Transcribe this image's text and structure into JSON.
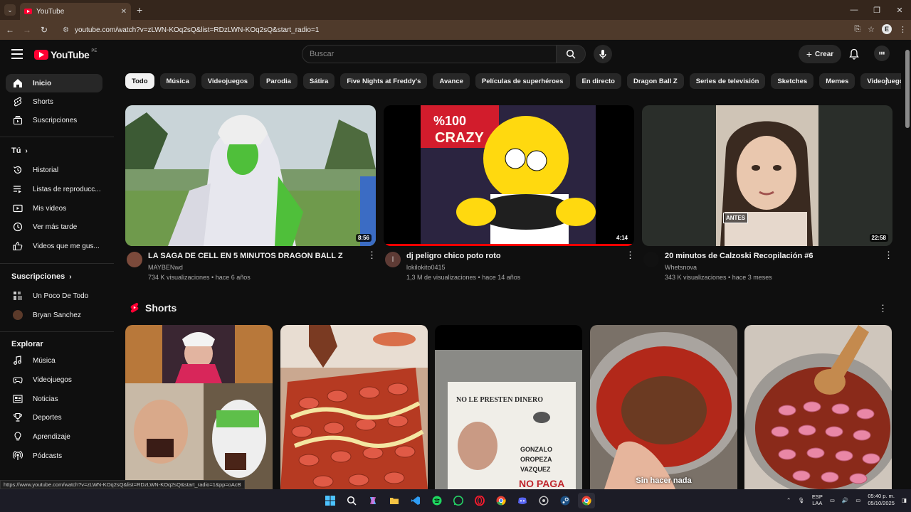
{
  "browser": {
    "tab_title": "YouTube",
    "url": "youtube.com/watch?v=zLWN-KOq2sQ&list=RDzLWN-KOq2sQ&start_radio=1",
    "status_url": "https://www.youtube.com/watch?v=zLWN-KOq2sQ&list=RDzLWN-KOq2sQ&start_radio=1&pp=oAcB"
  },
  "header": {
    "logo_text": "YouTube",
    "country": "PE",
    "search_placeholder": "Buscar",
    "create_label": "Crear"
  },
  "sidebar": {
    "main": [
      {
        "label": "Inicio",
        "icon": "home-icon"
      },
      {
        "label": "Shorts",
        "icon": "shorts-icon"
      },
      {
        "label": "Suscripciones",
        "icon": "subscriptions-icon"
      }
    ],
    "you_heading": "Tú",
    "you_items": [
      {
        "label": "Historial",
        "icon": "history-icon"
      },
      {
        "label": "Listas de reproducc...",
        "icon": "playlist-icon"
      },
      {
        "label": "Mis videos",
        "icon": "my-videos-icon"
      },
      {
        "label": "Ver más tarde",
        "icon": "watch-later-icon"
      },
      {
        "label": "Videos que me gus...",
        "icon": "like-icon"
      }
    ],
    "subs_heading": "Suscripciones",
    "subs_items": [
      {
        "label": "Un Poco De Todo"
      },
      {
        "label": "Bryan Sanchez"
      }
    ],
    "explore_heading": "Explorar",
    "explore_items": [
      {
        "label": "Música",
        "icon": "music-icon"
      },
      {
        "label": "Videojuegos",
        "icon": "gaming-icon"
      },
      {
        "label": "Noticias",
        "icon": "news-icon"
      },
      {
        "label": "Deportes",
        "icon": "trophy-icon"
      },
      {
        "label": "Aprendizaje",
        "icon": "bulb-icon"
      },
      {
        "label": "Pódcasts",
        "icon": "podcast-icon"
      }
    ]
  },
  "chips": [
    "Todo",
    "Música",
    "Videojuegos",
    "Parodia",
    "Sátira",
    "Five Nights at Freddy's",
    "Avance",
    "Películas de superhéroes",
    "En directo",
    "Dragon Ball Z",
    "Series de televisión",
    "Sketches",
    "Memes",
    "Videojuego independiente"
  ],
  "videos": [
    {
      "title": "LA SAGA DE CELL EN 5 MINUTOS DRAGON BALL Z",
      "channel": "MAYBENwd",
      "meta": "734 K visualizaciones • hace 6 años",
      "duration": "8:56"
    },
    {
      "title": "dj peligro chico poto roto",
      "channel": "lokilokito0415",
      "meta": "1,3 M de visualizaciones • hace 14 años",
      "duration": "4:14",
      "avatar_letter": "l",
      "watched_fraction": 1.0
    },
    {
      "title": "20 minutos de Calzoski Recopilación #6",
      "channel": "Whetsnova",
      "meta": "343 K visualizaciones • hace 3 meses",
      "duration": "22:58",
      "badge": "ANTES"
    }
  ],
  "shorts": {
    "heading": "Shorts",
    "items": [
      {
        "caption": ""
      },
      {
        "caption": ""
      },
      {
        "caption": "",
        "poster_text": "NO LE PRESTEN DINERO",
        "poster_name": "GONZALO OROPEZA VAZQUEZ"
      },
      {
        "caption": "Sin hacer nada"
      },
      {
        "caption": ""
      }
    ]
  },
  "taskbar": {
    "lang_line1": "ESP",
    "lang_line2": "LAA",
    "time": "05:40 p. m.",
    "date": "05/10/2025"
  },
  "colors": {
    "background": "#0f0f0f",
    "accent": "#ff0033",
    "chip": "#272727",
    "browser_frame": "#4f3a2b"
  }
}
